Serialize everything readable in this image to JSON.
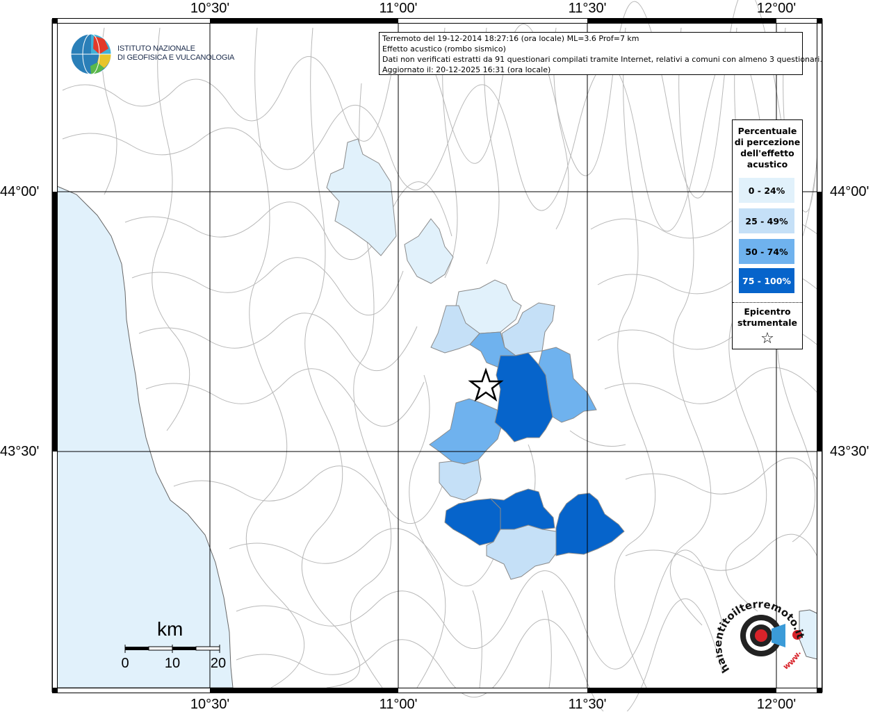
{
  "map": {
    "lon_labels": [
      "10°30'",
      "11°00'",
      "11°30'",
      "12°00'"
    ],
    "lat_labels": [
      "44°00'",
      "43°30'"
    ]
  },
  "logo": {
    "line1": "ISTITUTO NAZIONALE",
    "line2": "DI GEOFISICA E VULCANOLOGIA"
  },
  "info": {
    "line1": "Terremoto del 19-12-2014 18:27:16 (ora locale) ML=3.6 Prof=7 km",
    "line2": "Effetto acustico (rombo sismico)",
    "line3": "Dati non verificati estratti da 91 questionari compilati tramite Internet, relativi a comuni con almeno 3 questionari.",
    "line4": "Aggiornato il: 20-12-2025 16:31 (ora locale)"
  },
  "legend": {
    "title_lines": [
      "Percentuale",
      "di percezione",
      "dell'effetto",
      "acustico"
    ],
    "items": [
      {
        "label": "0 - 24%",
        "color": "#e1f1fb"
      },
      {
        "label": "25 - 49%",
        "color": "#c5e0f7"
      },
      {
        "label": "50 - 74%",
        "color": "#6fb2ee"
      },
      {
        "label": "75 - 100%",
        "color": "#0664cb"
      }
    ],
    "epicenter_lines": [
      "Epicentro",
      "strumentale"
    ],
    "star_symbol": "☆"
  },
  "scale": {
    "unit": "km",
    "ticks": [
      "0",
      "10",
      "20"
    ]
  },
  "brand": {
    "text": "haisentitoilterremoto.it",
    "url_text": "www."
  },
  "colors": {
    "sea": "#e1f1fb",
    "grid": "#000000",
    "boundaries": "#b0b0b0"
  }
}
